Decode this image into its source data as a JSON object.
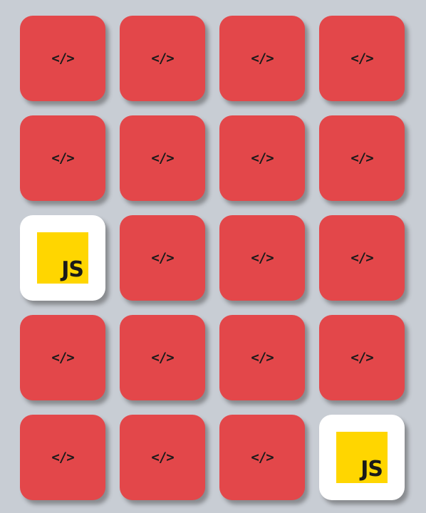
{
  "game": {
    "rows": 5,
    "columns": 4,
    "back_glyph": "</>",
    "colors": {
      "background": "#c8cdd4",
      "card_back": "#e3474a",
      "card_front": "#ffffff",
      "js_logo_yellow": "#ffd600",
      "glyph": "#1a1a1a"
    },
    "cards": [
      {
        "face": "back",
        "icon": "code-icon"
      },
      {
        "face": "back",
        "icon": "code-icon"
      },
      {
        "face": "back",
        "icon": "code-icon"
      },
      {
        "face": "back",
        "icon": "code-icon"
      },
      {
        "face": "back",
        "icon": "code-icon"
      },
      {
        "face": "back",
        "icon": "code-icon"
      },
      {
        "face": "back",
        "icon": "code-icon"
      },
      {
        "face": "back",
        "icon": "code-icon"
      },
      {
        "face": "up",
        "icon": "javascript-logo-icon",
        "label": "JS"
      },
      {
        "face": "back",
        "icon": "code-icon"
      },
      {
        "face": "back",
        "icon": "code-icon"
      },
      {
        "face": "back",
        "icon": "code-icon"
      },
      {
        "face": "back",
        "icon": "code-icon"
      },
      {
        "face": "back",
        "icon": "code-icon"
      },
      {
        "face": "back",
        "icon": "code-icon"
      },
      {
        "face": "back",
        "icon": "code-icon"
      },
      {
        "face": "back",
        "icon": "code-icon"
      },
      {
        "face": "back",
        "icon": "code-icon"
      },
      {
        "face": "back",
        "icon": "code-icon"
      },
      {
        "face": "up",
        "icon": "javascript-logo-icon",
        "label": "JS"
      }
    ]
  }
}
